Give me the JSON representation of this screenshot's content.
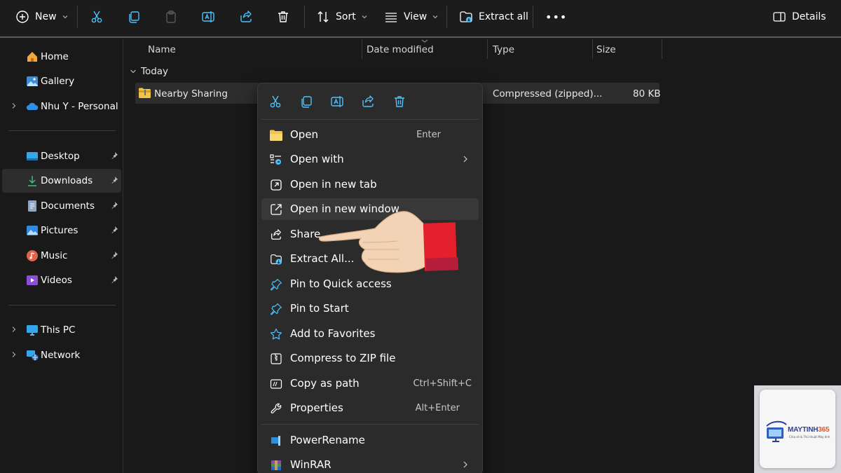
{
  "toolbar": {
    "new_label": "New",
    "sort_label": "Sort",
    "view_label": "View",
    "extract_all_label": "Extract all",
    "more_label": "•••",
    "details_label": "Details"
  },
  "sidebar": {
    "items": [
      {
        "label": "Home",
        "icon": "home-icon"
      },
      {
        "label": "Gallery",
        "icon": "gallery-icon"
      },
      {
        "label": "Nhu Y - Personal",
        "icon": "cloud-icon"
      },
      {
        "label": "Desktop",
        "icon": "desktop-icon",
        "pinned": true
      },
      {
        "label": "Downloads",
        "icon": "download-icon",
        "pinned": true,
        "selected": true
      },
      {
        "label": "Documents",
        "icon": "documents-icon",
        "pinned": true
      },
      {
        "label": "Pictures",
        "icon": "pictures-icon",
        "pinned": true
      },
      {
        "label": "Music",
        "icon": "music-icon",
        "pinned": true
      },
      {
        "label": "Videos",
        "icon": "videos-icon",
        "pinned": true
      },
      {
        "label": "This PC",
        "icon": "pc-icon"
      },
      {
        "label": "Network",
        "icon": "network-icon"
      }
    ]
  },
  "columns": {
    "name": "Name",
    "date_modified": "Date modified",
    "type": "Type",
    "size": "Size"
  },
  "group": {
    "label": "Today"
  },
  "file": {
    "name": "Nearby Sharing",
    "type": "Compressed (zipped)...",
    "size": "80 KB"
  },
  "context_menu": {
    "items": [
      {
        "label": "Open",
        "shortcut": "Enter",
        "icon": "folder-open-icon"
      },
      {
        "label": "Open with",
        "shortcut": "",
        "icon": "open-with-icon",
        "submenu": true
      },
      {
        "label": "Open in new tab",
        "shortcut": "",
        "icon": "new-tab-icon"
      },
      {
        "label": "Open in new window",
        "shortcut": "",
        "icon": "new-window-icon",
        "hover": true
      },
      {
        "label": "Share",
        "shortcut": "",
        "icon": "share-icon"
      },
      {
        "label": "Extract All...",
        "shortcut": "",
        "icon": "extract-icon"
      },
      {
        "label": "Pin to Quick access",
        "shortcut": "",
        "icon": "pin-icon"
      },
      {
        "label": "Pin to Start",
        "shortcut": "",
        "icon": "pin-start-icon"
      },
      {
        "label": "Add to Favorites",
        "shortcut": "",
        "icon": "star-icon"
      },
      {
        "label": "Compress to ZIP file",
        "shortcut": "",
        "icon": "zip-icon"
      },
      {
        "label": "Copy as path",
        "shortcut": "Ctrl+Shift+C",
        "icon": "copy-path-icon"
      },
      {
        "label": "Properties",
        "shortcut": "Alt+Enter",
        "icon": "wrench-icon"
      },
      {
        "label": "PowerRename",
        "shortcut": "",
        "icon": "powerrename-icon"
      },
      {
        "label": "WinRAR",
        "shortcut": "",
        "icon": "winrar-icon",
        "submenu": true
      }
    ]
  },
  "logo": {
    "brand_a": "MAYTINH",
    "brand_b": "365",
    "tagline": "Chia sẻ & Thủ thuật Máy tính"
  },
  "colors": {
    "accent": "#4cc2ff",
    "background": "#191919",
    "menu_bg": "#2b2b2b",
    "selected_row": "#2d2d2d"
  }
}
